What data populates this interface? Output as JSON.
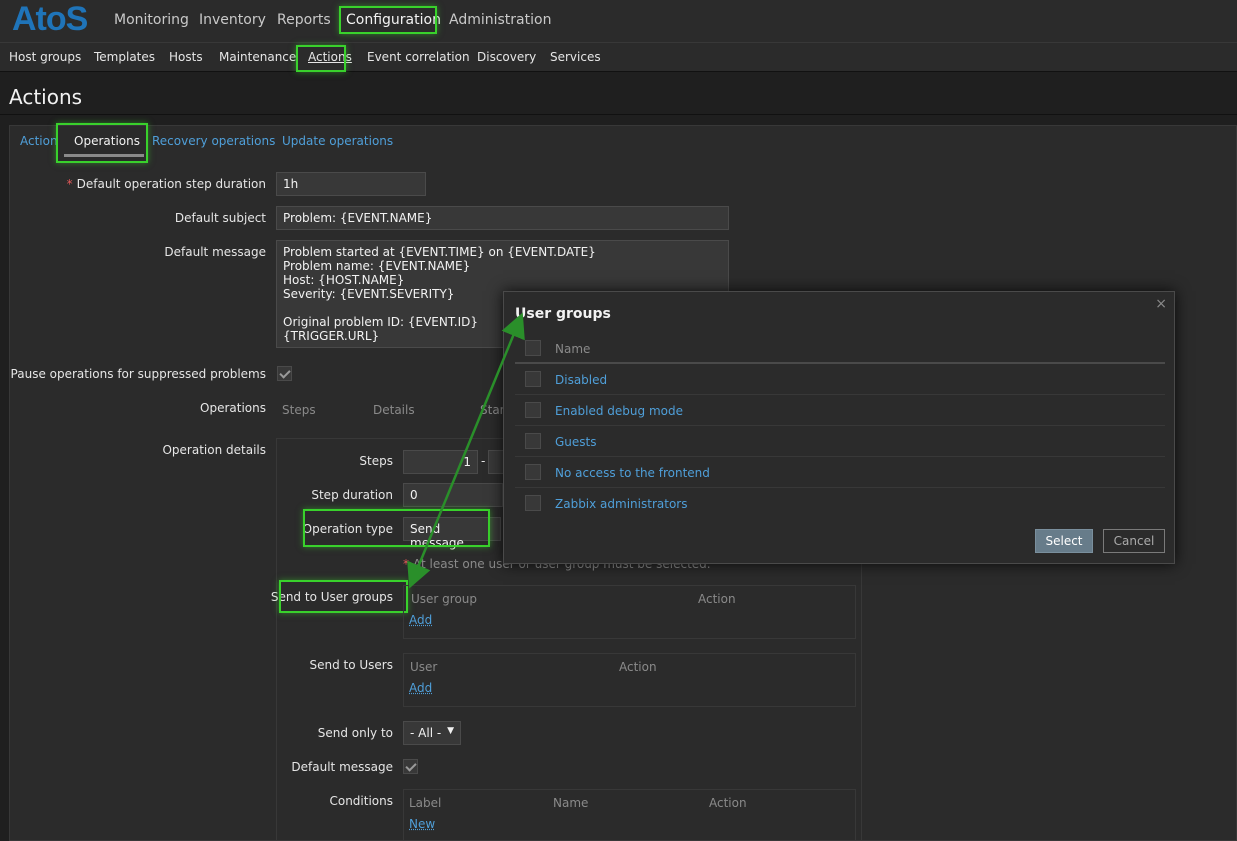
{
  "brand": {
    "logo_text": "AtoS",
    "color": "#1f74b9"
  },
  "top_menu": [
    "Monitoring",
    "Inventory",
    "Reports",
    "Configuration",
    "Administration"
  ],
  "sub_menu": [
    "Host groups",
    "Templates",
    "Hosts",
    "Maintenance",
    "Actions",
    "Event correlation",
    "Discovery",
    "Services"
  ],
  "page_title": "Actions",
  "tabs": [
    "Action",
    "Operations",
    "Recovery operations",
    "Update operations"
  ],
  "form": {
    "step_duration": {
      "label": "Default operation step duration",
      "value": "1h"
    },
    "subject": {
      "label": "Default subject",
      "value": "Problem: {EVENT.NAME}"
    },
    "message": {
      "label": "Default message",
      "value": "Problem started at {EVENT.TIME} on {EVENT.DATE}\nProblem name: {EVENT.NAME}\nHost: {HOST.NAME}\nSeverity: {EVENT.SEVERITY}\n\nOriginal problem ID: {EVENT.ID}\n{TRIGGER.URL}"
    },
    "pause_label": "Pause operations for suppressed problems",
    "operations": {
      "label": "Operations",
      "headers": [
        "Steps",
        "Details",
        "Start"
      ]
    },
    "operation_details_label": "Operation details",
    "steps": {
      "label": "Steps",
      "from": "1",
      "separator": "-"
    },
    "step_dur": {
      "label": "Step duration",
      "value": "0"
    },
    "op_type": {
      "label": "Operation type",
      "value": "Send message"
    },
    "warning": "At least one user or user group must be selected.",
    "send_groups": {
      "label": "Send to User groups",
      "headers": [
        "User group",
        "Action"
      ],
      "add": "Add"
    },
    "send_users": {
      "label": "Send to Users",
      "headers": [
        "User",
        "Action"
      ],
      "add": "Add"
    },
    "send_only": {
      "label": "Send only to",
      "value": "- All -"
    },
    "default_message_label": "Default message",
    "conditions": {
      "label": "Conditions",
      "headers": [
        "Label",
        "Name",
        "Action"
      ],
      "new": "New"
    }
  },
  "modal": {
    "title": "User groups",
    "name_header": "Name",
    "groups": [
      "Disabled",
      "Enabled debug mode",
      "Guests",
      "No access to the frontend",
      "Zabbix administrators"
    ],
    "select": "Select",
    "cancel": "Cancel",
    "close_icon": "×"
  },
  "colors": {
    "highlight": "#39d12c",
    "link": "#4f9fd9",
    "arrow": "#2a8f2a"
  }
}
